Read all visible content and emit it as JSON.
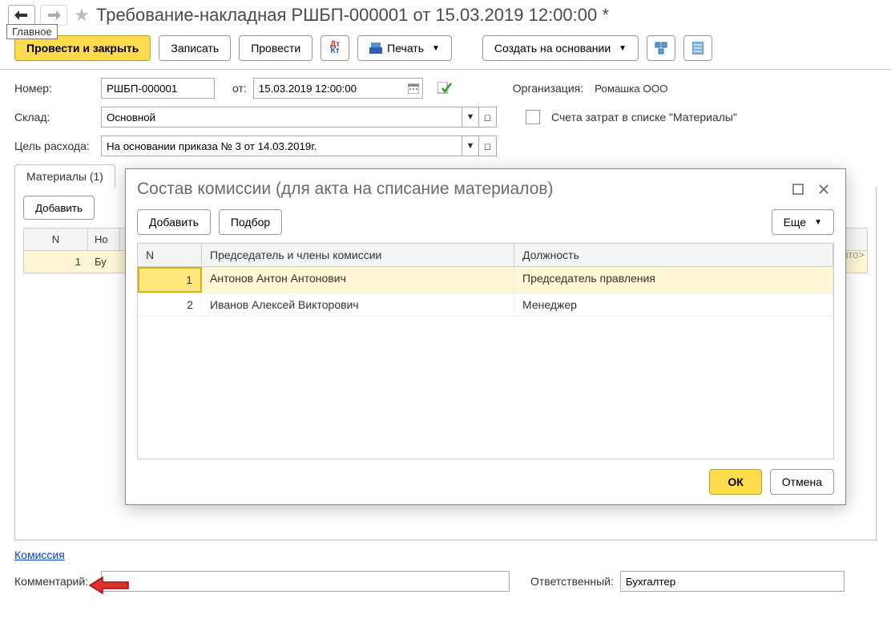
{
  "tooltip": "Главное",
  "title": "Требование-накладная РШБП-000001 от 15.03.2019 12:00:00 *",
  "toolbar": {
    "post_close": "Провести и закрыть",
    "save": "Записать",
    "post": "Провести",
    "print": "Печать",
    "create_basis": "Создать на основании"
  },
  "form": {
    "number_label": "Номер:",
    "number_value": "РШБП-000001",
    "from_label": "от:",
    "date_value": "15.03.2019 12:00:00",
    "org_label": "Организация:",
    "org_value": "Ромашка ООО",
    "warehouse_label": "Склад:",
    "warehouse_value": "Основной",
    "cost_accounts_label": "Счета затрат в списке \"Материалы\"",
    "purpose_label": "Цель расхода:",
    "purpose_value": "На основании приказа № 3 от 14.03.2019г."
  },
  "tabs": {
    "materials_label": "Материалы (1)"
  },
  "materials_table": {
    "add": "Добавить",
    "col_n": "N",
    "col_nomen": "Но",
    "row1_n": "1",
    "row1_val": "Бу",
    "auto": "вто>"
  },
  "link_commission": "Комиссия",
  "footer": {
    "comment_label": "Комментарий:",
    "responsible_label": "Ответственный:",
    "responsible_value": "Бухгалтер"
  },
  "dialog": {
    "title": "Состав комиссии (для акта на списание материалов)",
    "add": "Добавить",
    "pick": "Подбор",
    "more": "Еще",
    "col_n": "N",
    "col_member": "Председатель и члены комиссии",
    "col_position": "Должность",
    "rows": [
      {
        "n": "1",
        "member": "Антонов Антон Антонович",
        "position": "Председатель правления"
      },
      {
        "n": "2",
        "member": "Иванов Алексей Викторович",
        "position": "Менеджер"
      }
    ],
    "ok": "ОК",
    "cancel": "Отмена"
  }
}
